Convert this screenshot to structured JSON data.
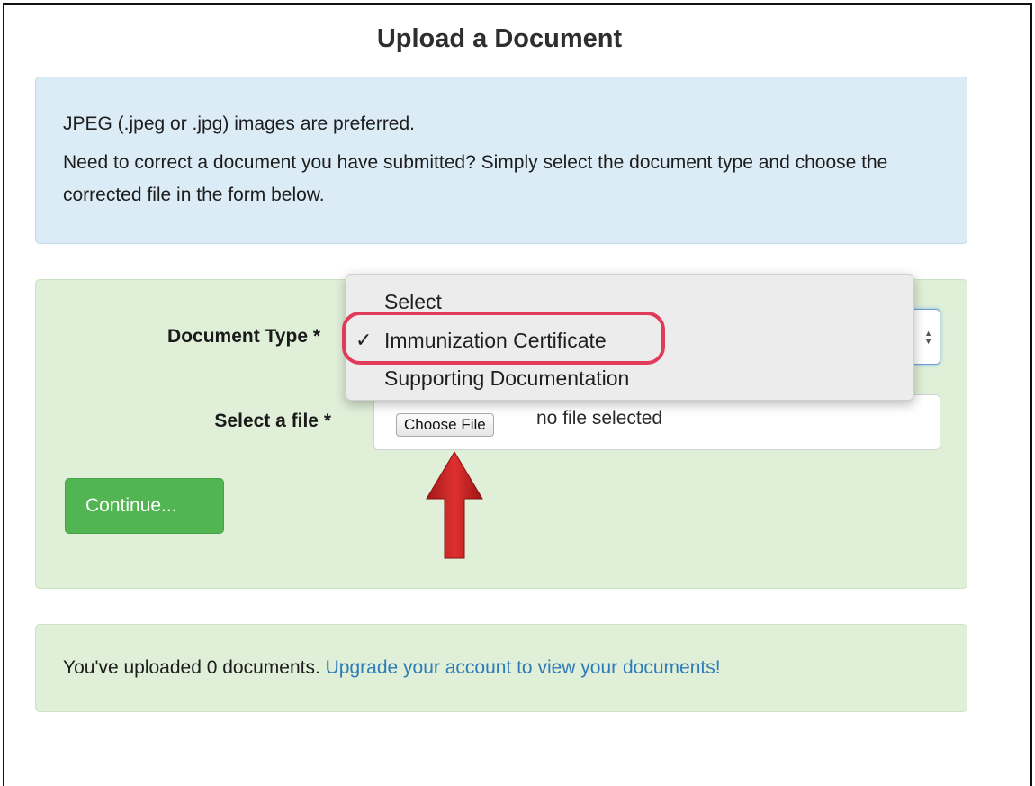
{
  "page": {
    "title": "Upload a Document"
  },
  "info": {
    "line1": "JPEG (.jpeg or .jpg) images are preferred.",
    "line2": "Need to correct a document you have submitted? Simply select the document type and choose the corrected file in the form below."
  },
  "form": {
    "document_type_label": "Document Type *",
    "select_file_label": "Select a file *",
    "choose_file_button": "Choose File",
    "no_file_text": "no file selected",
    "continue_button": "Continue..."
  },
  "dropdown": {
    "options": [
      "Select",
      "Immunization Certificate",
      "Supporting Documentation"
    ],
    "checkmark": "✓",
    "selected": "Immunization Certificate"
  },
  "status": {
    "text": "You've uploaded 0 documents.",
    "link": "Upgrade your account to view your documents!"
  },
  "colors": {
    "info_bg": "#dbecf6",
    "form_bg": "#dfefd8",
    "continue_green": "#51b651",
    "highlight_red": "#e13a5b",
    "arrow_red": "#c81e1e",
    "link_blue": "#2f7bb8"
  },
  "icons": {
    "select_arrows": "updown-chevron-icon",
    "annotation_arrow": "red-up-arrow-icon"
  }
}
